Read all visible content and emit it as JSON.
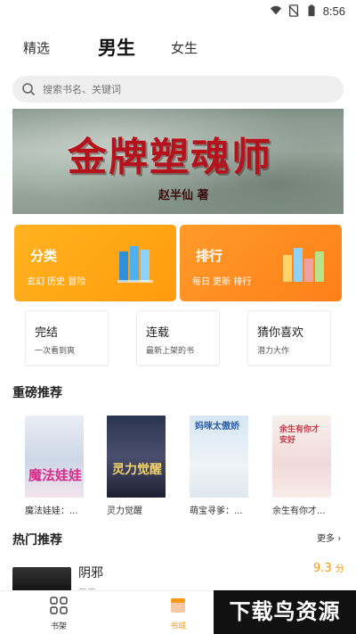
{
  "status_bar": {
    "time": "8:56"
  },
  "tabs": {
    "featured": "精选",
    "male": "男生",
    "female": "女生"
  },
  "search": {
    "placeholder": "搜索书名、关键词"
  },
  "banner": {
    "title": "金牌塑魂师",
    "author": "赵半仙  著"
  },
  "category_cards": [
    {
      "title": "分类",
      "subtitle": "玄幻 历史 冒险"
    },
    {
      "title": "排行",
      "subtitle": "每日 更新 排行"
    }
  ],
  "quick_boxes": [
    {
      "title": "完结",
      "subtitle": "一次看到爽"
    },
    {
      "title": "连载",
      "subtitle": "最新上架的书"
    },
    {
      "title": "猜你喜欢",
      "subtitle": "潜力大作"
    }
  ],
  "sections": {
    "recommended": "重磅推荐",
    "hot": "热门推荐",
    "more": "更多"
  },
  "books": [
    {
      "name": "魔法娃娃：...",
      "cover_text": "魔法娃娃"
    },
    {
      "name": "灵力觉醒",
      "cover_text": "灵力觉醒"
    },
    {
      "name": "萌宝寻爹：...",
      "cover_text": "妈咪太傲娇"
    },
    {
      "name": "余生有你才...",
      "cover_text": "余生有你才安好"
    }
  ],
  "hot_item": {
    "title": "阴邪",
    "score": "9.3",
    "score_unit": "分",
    "subtitle": "三三"
  },
  "bottom_nav": {
    "shelf": "书架",
    "store": "书城"
  },
  "watermark": "下载鸟资源",
  "colors": {
    "accent": "#f39a14",
    "card_left": "#ffb21f",
    "card_right": "#ff8a1f",
    "banner_title": "#b5121b"
  }
}
